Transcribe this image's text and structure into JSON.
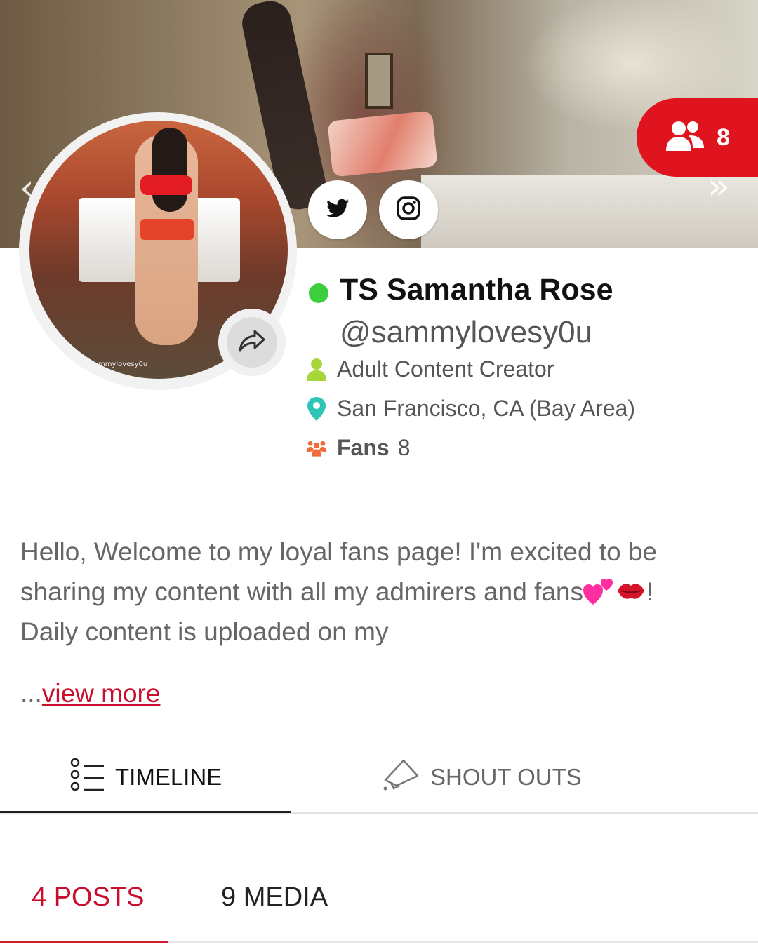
{
  "cover": {
    "fans_count": "8",
    "prev_glyph": "‹",
    "next_glyph": "»"
  },
  "social": {
    "twitter_icon": "twitter-icon",
    "instagram_icon": "instagram-icon"
  },
  "profile": {
    "online_status_color": "#3ccf3c",
    "name": "TS Samantha Rose",
    "handle": "@sammylovesy0u",
    "role": "Adult Content Creator",
    "location": "San Francisco, CA (Bay Area)",
    "fans_label": "Fans",
    "fans_count": "8",
    "avatar_watermark": "mmylovesy0u"
  },
  "bio": {
    "line1": "Hello, Welcome to my loyal fans page! I'm excited to be",
    "line2_text": "sharing my content with all my admirers and fans",
    "line2_end": "!",
    "line3": "Daily content is uploaded on my",
    "ellipsis": "...",
    "view_more": "view more"
  },
  "tabs": {
    "timeline": "TIMELINE",
    "shout_outs": "SHOUT OUTS",
    "active": "timeline"
  },
  "subtabs": {
    "posts": "4 POSTS",
    "media": "9 MEDIA",
    "active": "posts"
  },
  "colors": {
    "brand_red": "#e0141e",
    "link_red": "#c8102e",
    "role_icon": "#a6d63a",
    "location_icon": "#2ec4b6",
    "fans_icon": "#f06a3a"
  }
}
